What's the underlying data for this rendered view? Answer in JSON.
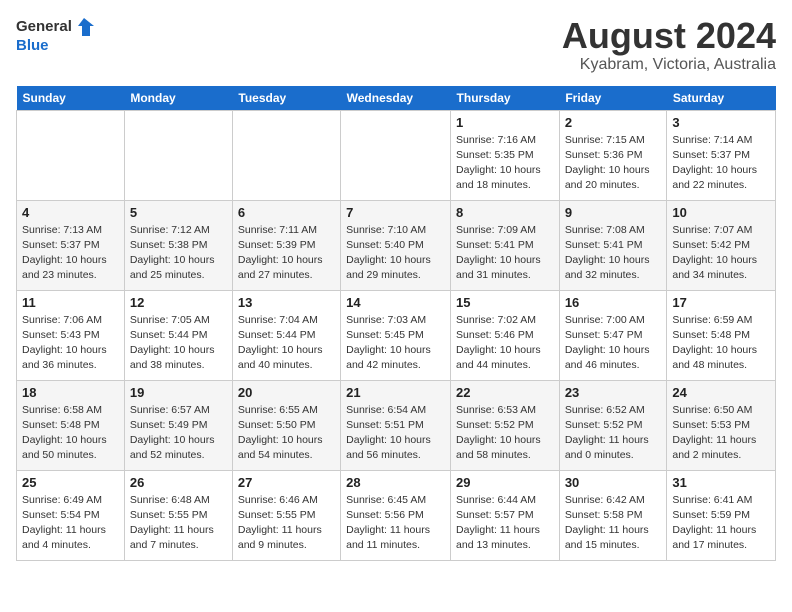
{
  "logo": {
    "line1": "General",
    "line2": "Blue"
  },
  "title": {
    "month_year": "August 2024",
    "location": "Kyabram, Victoria, Australia"
  },
  "days_of_week": [
    "Sunday",
    "Monday",
    "Tuesday",
    "Wednesday",
    "Thursday",
    "Friday",
    "Saturday"
  ],
  "weeks": [
    [
      {
        "day": "",
        "info": ""
      },
      {
        "day": "",
        "info": ""
      },
      {
        "day": "",
        "info": ""
      },
      {
        "day": "",
        "info": ""
      },
      {
        "day": "1",
        "info": "Sunrise: 7:16 AM\nSunset: 5:35 PM\nDaylight: 10 hours\nand 18 minutes."
      },
      {
        "day": "2",
        "info": "Sunrise: 7:15 AM\nSunset: 5:36 PM\nDaylight: 10 hours\nand 20 minutes."
      },
      {
        "day": "3",
        "info": "Sunrise: 7:14 AM\nSunset: 5:37 PM\nDaylight: 10 hours\nand 22 minutes."
      }
    ],
    [
      {
        "day": "4",
        "info": "Sunrise: 7:13 AM\nSunset: 5:37 PM\nDaylight: 10 hours\nand 23 minutes."
      },
      {
        "day": "5",
        "info": "Sunrise: 7:12 AM\nSunset: 5:38 PM\nDaylight: 10 hours\nand 25 minutes."
      },
      {
        "day": "6",
        "info": "Sunrise: 7:11 AM\nSunset: 5:39 PM\nDaylight: 10 hours\nand 27 minutes."
      },
      {
        "day": "7",
        "info": "Sunrise: 7:10 AM\nSunset: 5:40 PM\nDaylight: 10 hours\nand 29 minutes."
      },
      {
        "day": "8",
        "info": "Sunrise: 7:09 AM\nSunset: 5:41 PM\nDaylight: 10 hours\nand 31 minutes."
      },
      {
        "day": "9",
        "info": "Sunrise: 7:08 AM\nSunset: 5:41 PM\nDaylight: 10 hours\nand 32 minutes."
      },
      {
        "day": "10",
        "info": "Sunrise: 7:07 AM\nSunset: 5:42 PM\nDaylight: 10 hours\nand 34 minutes."
      }
    ],
    [
      {
        "day": "11",
        "info": "Sunrise: 7:06 AM\nSunset: 5:43 PM\nDaylight: 10 hours\nand 36 minutes."
      },
      {
        "day": "12",
        "info": "Sunrise: 7:05 AM\nSunset: 5:44 PM\nDaylight: 10 hours\nand 38 minutes."
      },
      {
        "day": "13",
        "info": "Sunrise: 7:04 AM\nSunset: 5:44 PM\nDaylight: 10 hours\nand 40 minutes."
      },
      {
        "day": "14",
        "info": "Sunrise: 7:03 AM\nSunset: 5:45 PM\nDaylight: 10 hours\nand 42 minutes."
      },
      {
        "day": "15",
        "info": "Sunrise: 7:02 AM\nSunset: 5:46 PM\nDaylight: 10 hours\nand 44 minutes."
      },
      {
        "day": "16",
        "info": "Sunrise: 7:00 AM\nSunset: 5:47 PM\nDaylight: 10 hours\nand 46 minutes."
      },
      {
        "day": "17",
        "info": "Sunrise: 6:59 AM\nSunset: 5:48 PM\nDaylight: 10 hours\nand 48 minutes."
      }
    ],
    [
      {
        "day": "18",
        "info": "Sunrise: 6:58 AM\nSunset: 5:48 PM\nDaylight: 10 hours\nand 50 minutes."
      },
      {
        "day": "19",
        "info": "Sunrise: 6:57 AM\nSunset: 5:49 PM\nDaylight: 10 hours\nand 52 minutes."
      },
      {
        "day": "20",
        "info": "Sunrise: 6:55 AM\nSunset: 5:50 PM\nDaylight: 10 hours\nand 54 minutes."
      },
      {
        "day": "21",
        "info": "Sunrise: 6:54 AM\nSunset: 5:51 PM\nDaylight: 10 hours\nand 56 minutes."
      },
      {
        "day": "22",
        "info": "Sunrise: 6:53 AM\nSunset: 5:52 PM\nDaylight: 10 hours\nand 58 minutes."
      },
      {
        "day": "23",
        "info": "Sunrise: 6:52 AM\nSunset: 5:52 PM\nDaylight: 11 hours\nand 0 minutes."
      },
      {
        "day": "24",
        "info": "Sunrise: 6:50 AM\nSunset: 5:53 PM\nDaylight: 11 hours\nand 2 minutes."
      }
    ],
    [
      {
        "day": "25",
        "info": "Sunrise: 6:49 AM\nSunset: 5:54 PM\nDaylight: 11 hours\nand 4 minutes."
      },
      {
        "day": "26",
        "info": "Sunrise: 6:48 AM\nSunset: 5:55 PM\nDaylight: 11 hours\nand 7 minutes."
      },
      {
        "day": "27",
        "info": "Sunrise: 6:46 AM\nSunset: 5:55 PM\nDaylight: 11 hours\nand 9 minutes."
      },
      {
        "day": "28",
        "info": "Sunrise: 6:45 AM\nSunset: 5:56 PM\nDaylight: 11 hours\nand 11 minutes."
      },
      {
        "day": "29",
        "info": "Sunrise: 6:44 AM\nSunset: 5:57 PM\nDaylight: 11 hours\nand 13 minutes."
      },
      {
        "day": "30",
        "info": "Sunrise: 6:42 AM\nSunset: 5:58 PM\nDaylight: 11 hours\nand 15 minutes."
      },
      {
        "day": "31",
        "info": "Sunrise: 6:41 AM\nSunset: 5:59 PM\nDaylight: 11 hours\nand 17 minutes."
      }
    ]
  ]
}
